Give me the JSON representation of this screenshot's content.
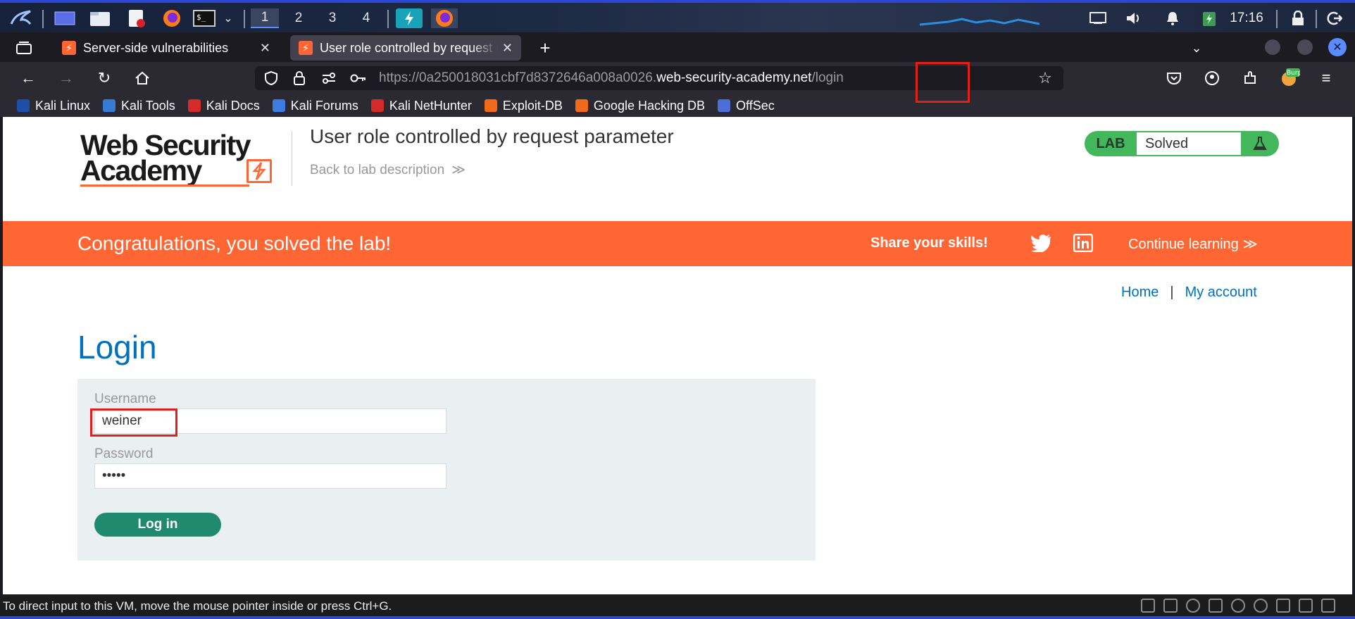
{
  "taskbar": {
    "workspaces": [
      "1",
      "2",
      "3",
      "4"
    ],
    "active_workspace": 0,
    "clock": "17:16",
    "app_icons": [
      "kali-menu-icon",
      "desktop-icon",
      "file-manager-icon",
      "text-editor-icon",
      "firefox-icon",
      "terminal-icon",
      "dropdown-icon",
      "burp-suite-icon",
      "firefox-active-icon"
    ],
    "tray_icons": [
      "network-icon",
      "volume-icon",
      "bell-icon",
      "battery-icon",
      "lock-icon",
      "logout-icon"
    ]
  },
  "browser": {
    "tabs": [
      {
        "label": "Server-side vulnerabilities",
        "active": false
      },
      {
        "label": "User role controlled by request parameter",
        "active": true
      }
    ],
    "url": {
      "prefix": "https://0a250018031cbf7d8372646a008a0026.",
      "host": "web-security-academy.net",
      "path": "/login"
    },
    "bookmarks": [
      {
        "label": "Kali Linux",
        "color": "#1e4fa8"
      },
      {
        "label": "Kali Tools",
        "color": "#367bd6"
      },
      {
        "label": "Kali Docs",
        "color": "#d42a2a"
      },
      {
        "label": "Kali Forums",
        "color": "#3d7ce0"
      },
      {
        "label": "Kali NetHunter",
        "color": "#d42a2a"
      },
      {
        "label": "Exploit-DB",
        "color": "#f06a1a"
      },
      {
        "label": "Google Hacking DB",
        "color": "#f06a1a"
      },
      {
        "label": "OffSec",
        "color": "#4b6ed8"
      }
    ],
    "burp_badge": "Burp"
  },
  "page": {
    "logo": {
      "line1": "Web Security",
      "line2": "Academy"
    },
    "lab_title": "User role controlled by request parameter",
    "back_link": "Back to lab description",
    "lab_badge": {
      "label": "LAB",
      "status": "Solved"
    },
    "banner": {
      "congrats": "Congratulations, you solved the lab!",
      "share": "Share your skills!",
      "continue": "Continue learning"
    },
    "nav": {
      "home": "Home",
      "separator": "|",
      "account": "My account"
    },
    "login": {
      "heading": "Login",
      "username_label": "Username",
      "username_value": "weiner",
      "password_label": "Password",
      "password_value": "peter",
      "button": "Log in"
    }
  },
  "vm_status": {
    "message": "To direct input to this VM, move the mouse pointer inside or press Ctrl+G."
  },
  "colors": {
    "brand_orange": "#ff6633",
    "lab_green": "#44b65c",
    "link_blue": "#0071bc",
    "button_teal": "#1f8a6e",
    "highlight_red": "#e0201b"
  }
}
